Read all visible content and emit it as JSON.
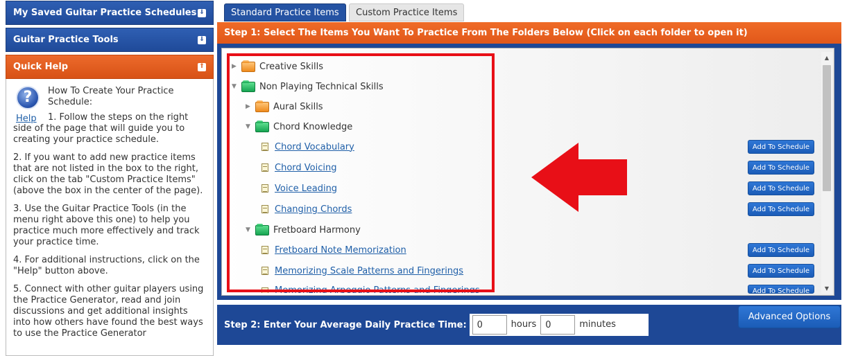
{
  "sidebar": {
    "saved_title": "My Saved Guitar Practice Schedules",
    "tools_title": "Guitar Practice Tools",
    "help_title": "Quick Help",
    "help_link": "Help",
    "help_intro": "How To Create Your Practice Schedule:",
    "help_step1": "1. Follow the steps on the right side of the page that will guide you to creating your practice schedule.",
    "help_step2": "2. If you want to add new practice items that are not listed in the box to the right, click on the tab \"Custom Practice Items\" (above the box in the center of the page).",
    "help_step3": "3. Use the Guitar Practice Tools (in the menu right above this one) to help you practice much more effectively and track your practice time.",
    "help_step4": "4. For additional instructions, click on the \"Help\" button above.",
    "help_step5": "5. Connect with other guitar players using the Practice Generator, read and join discussions and get additional insights into how others have found the best ways to use the Practice Generator"
  },
  "tabs": {
    "standard": "Standard Practice Items",
    "custom": "Custom Practice Items"
  },
  "step1": {
    "title": "Step 1: Select The Items You Want To Practice From The Folders Below (Click on each folder to open it)"
  },
  "tree": {
    "creative_skills": "Creative Skills",
    "non_playing": "Non Playing Technical Skills",
    "aural_skills": "Aural Skills",
    "chord_knowledge": "Chord Knowledge",
    "chord_vocabulary": "Chord Vocabulary",
    "chord_voicing": "Chord Voicing",
    "voice_leading": "Voice Leading",
    "changing_chords": "Changing Chords",
    "fretboard_harmony": "Fretboard Harmony",
    "fretboard_note": "Fretboard Note Memorization",
    "memorizing_scale": "Memorizing Scale Patterns and Fingerings",
    "memorizing_arpeggio": "Memorizing Arpeggio Patterns and Fingerings",
    "add_label": "Add To Schedule"
  },
  "step2": {
    "label": "Step 2: Enter Your Average Daily Practice Time:",
    "hours_value": "0",
    "hours_label": "hours",
    "minutes_value": "0",
    "minutes_label": "minutes"
  },
  "advanced_button": "Advanced Options",
  "colors": {
    "header_blue": "#1f4a99",
    "accent_orange": "#e1581a",
    "highlight_red": "#e80f17",
    "link_blue": "#1f5fa8"
  }
}
